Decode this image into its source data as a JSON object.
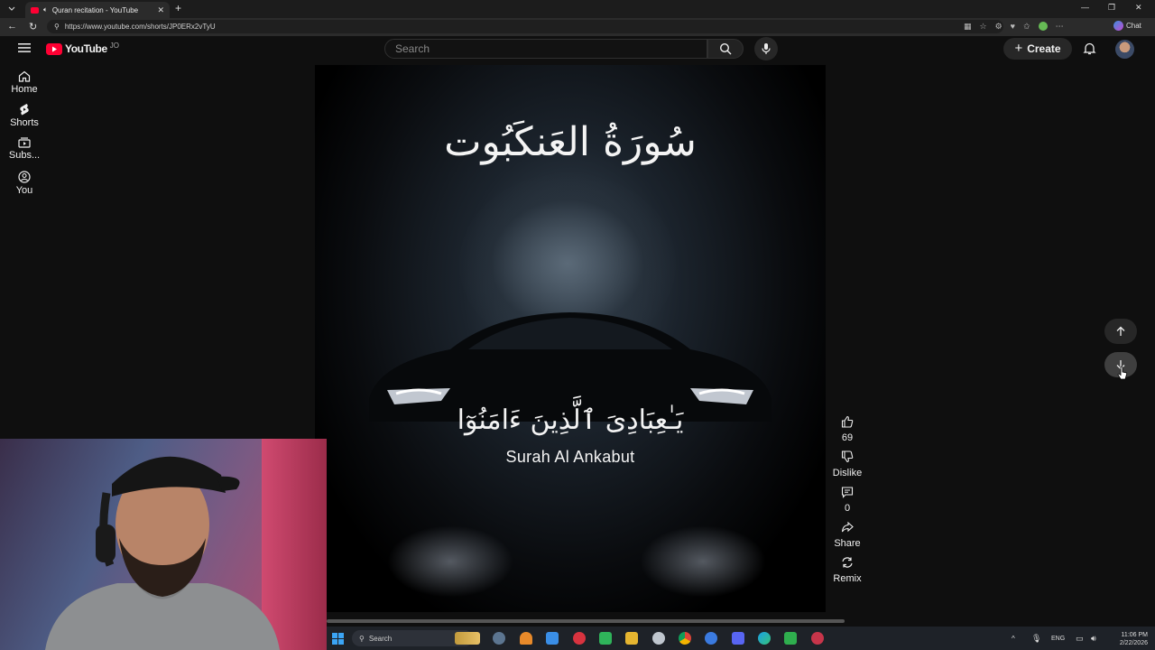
{
  "browser": {
    "tab_title": "Quran recitation - YouTube",
    "url": "https://www.youtube.com/shorts/JP0ERx2vTyU",
    "chat_label": "Chat"
  },
  "youtube": {
    "logo_text": "YouTube",
    "country_code": "JO",
    "search_placeholder": "Search",
    "create_label": "Create",
    "sidebar": [
      {
        "label": "Home",
        "icon": "home-icon"
      },
      {
        "label": "Shorts",
        "icon": "shorts-icon"
      },
      {
        "label": "Subs...",
        "icon": "subscriptions-icon"
      },
      {
        "label": "You",
        "icon": "you-icon"
      }
    ]
  },
  "video": {
    "arabic_title": "سُورَةُ العَنكَبُوت",
    "arabic_verse": "يَـٰعِبَادِىَ ٱلَّذِينَ ءَامَنُوٓا",
    "surah_label": "Surah Al Ankabut"
  },
  "actions": {
    "likes": "69",
    "dislike_label": "Dislike",
    "comments": "0",
    "share_label": "Share",
    "remix_label": "Remix"
  },
  "taskbar": {
    "search_label": "Search",
    "lang": "ENG",
    "time": "11:06 PM",
    "date": "2/22/2026"
  },
  "colors": {
    "yt_red": "#ff0033",
    "background": "#0f0f0f"
  }
}
